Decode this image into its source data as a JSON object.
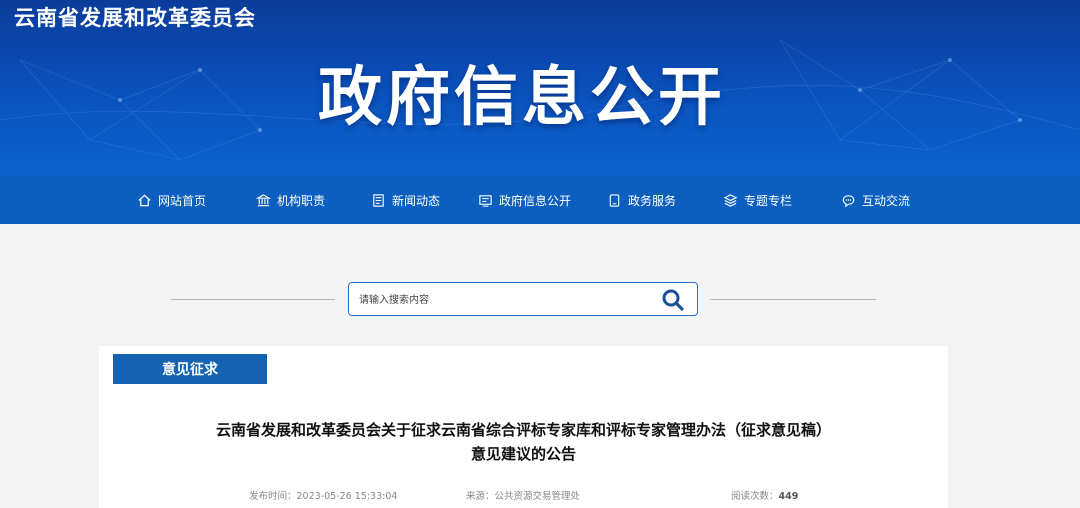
{
  "header": {
    "site_name": "云南省发展和改革委员会",
    "banner_title": "政府信息公开"
  },
  "nav": {
    "items": [
      {
        "label": "网站首页",
        "icon": "home-icon"
      },
      {
        "label": "机构职责",
        "icon": "institution-icon"
      },
      {
        "label": "新闻动态",
        "icon": "news-icon"
      },
      {
        "label": "政府信息公开",
        "icon": "info-disclosure-icon"
      },
      {
        "label": "政务服务",
        "icon": "service-icon"
      },
      {
        "label": "专题专栏",
        "icon": "layers-icon"
      },
      {
        "label": "互动交流",
        "icon": "chat-icon"
      }
    ]
  },
  "search": {
    "placeholder": "请输入搜索内容",
    "value": ""
  },
  "article": {
    "section_label": "意见征求",
    "title_line1": "云南省发展和改革委员会关于征求云南省综合评标专家库和评标专家管理办法（征求意见稿）",
    "title_line2": "意见建议的公告",
    "publish_label": "发布时间：",
    "publish_time": "2023-05-26 15:33:04",
    "source_label": "来源：",
    "source": "公共资源交易管理处",
    "views_label": "阅读次数：",
    "views": "449"
  },
  "colors": {
    "banner": "#0a4fb8",
    "nav": "#0c5fbe",
    "tab": "#1663b3",
    "search_border": "#2f6fc0"
  }
}
